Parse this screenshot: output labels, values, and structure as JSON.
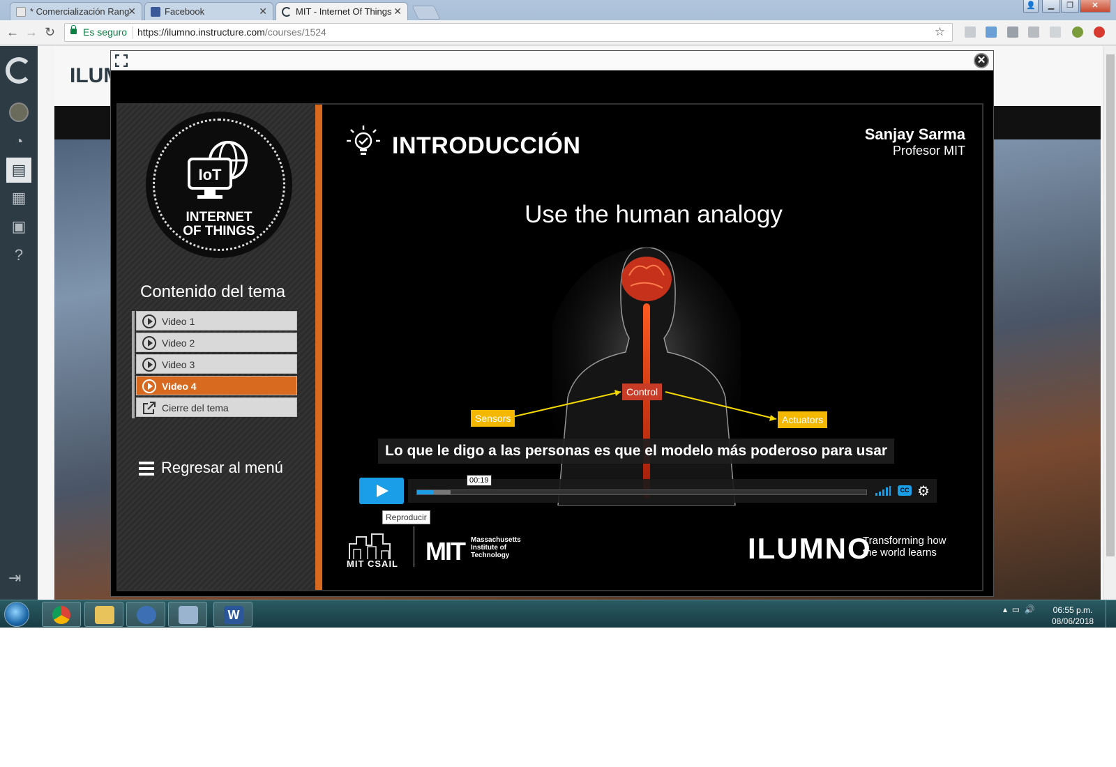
{
  "browser": {
    "tabs": [
      {
        "title": "* Comercialización Rang",
        "favicon": "document-icon",
        "active": false
      },
      {
        "title": "Facebook",
        "favicon": "facebook-icon",
        "active": false
      },
      {
        "title": "MIT - Internet Of Things",
        "favicon": "ilumno-icon",
        "active": true
      }
    ],
    "security_label": "Es seguro",
    "url_host": "https://ilumno.instructure.com",
    "url_path": "/courses/1524"
  },
  "lms": {
    "title_fragment": "ILUM"
  },
  "player": {
    "left_panel": {
      "badge_line1": "INTERNET",
      "badge_line2": "OF THINGS",
      "badge_iot": "IoT",
      "content_title": "Contenido del tema",
      "items": [
        {
          "label": "Video 1",
          "active": false,
          "icon": "play-circle-icon"
        },
        {
          "label": "Video 2",
          "active": false,
          "icon": "play-circle-icon"
        },
        {
          "label": "Video 3",
          "active": false,
          "icon": "play-circle-icon"
        },
        {
          "label": "Video 4",
          "active": true,
          "icon": "play-circle-icon"
        },
        {
          "label": "Cierre del tema",
          "active": false,
          "icon": "external-link-icon"
        }
      ],
      "back_label": "Regresar al menú"
    },
    "slide": {
      "section_title": "INTRODUCCIÓN",
      "presenter_name": "Sanjay Sarma",
      "presenter_role": "Profesor MIT",
      "headline": "Use the human analogy",
      "labels": {
        "sensors": "Sensors",
        "control": "Control",
        "actuators": "Actuators"
      },
      "caption": "Lo que le digo a las personas es que el modelo más poderoso para usar"
    },
    "controls": {
      "time": "00:19",
      "progress_fraction": 0.035,
      "buffered_fraction": 0.075,
      "cc_label": "CC",
      "tooltip": "Reproducir"
    },
    "footer": {
      "csail_label": "MIT CSAIL",
      "mit_mark": "MIT",
      "mit_name_line1": "Massachusetts",
      "mit_name_line2": "Institute of",
      "mit_name_line3": "Technology",
      "ilumno": "ILUMNO",
      "ilumno_tag_line1": "Transforming how",
      "ilumno_tag_line2": "the world learns"
    }
  },
  "taskbar": {
    "time": "06:55 p.m.",
    "date": "08/06/2018"
  },
  "colors": {
    "accent_orange": "#d86a1f",
    "player_blue": "#1a9ee8",
    "sensor_yellow": "#f5b800",
    "control_red": "#c83b27"
  }
}
